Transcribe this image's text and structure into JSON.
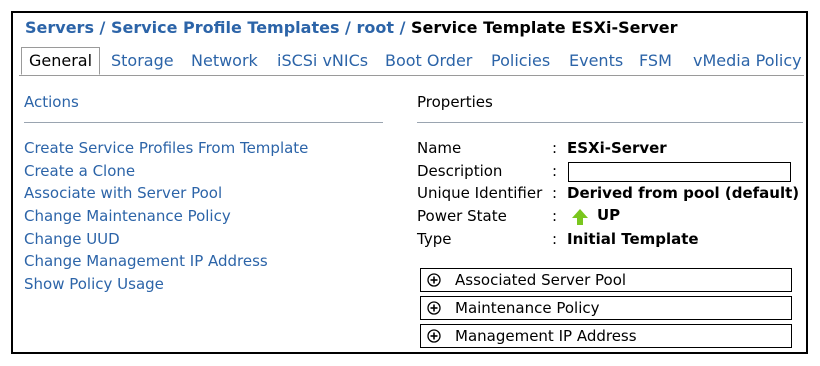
{
  "breadcrumb": {
    "servers": "Servers",
    "sep1": " / ",
    "spt": "Service Profile Templates",
    "sep2": " / ",
    "root": "root",
    "sep3": " / ",
    "current": "Service Template ESXi-Server"
  },
  "tabs": [
    {
      "label": "General",
      "active": true
    },
    {
      "label": "Storage"
    },
    {
      "label": "Network"
    },
    {
      "label": "iSCSi vNICs"
    },
    {
      "label": "Boot Order"
    },
    {
      "label": "Policies"
    },
    {
      "label": "Events"
    },
    {
      "label": "FSM"
    },
    {
      "label": "vMedia Policy"
    }
  ],
  "actions": {
    "title": "Actions",
    "items": [
      "Create Service Profiles From Template",
      "Create a Clone",
      "Associate with Server Pool",
      "Change Maintenance Policy",
      "Change UUD",
      "Change Management IP Address",
      "Show Policy Usage"
    ]
  },
  "properties": {
    "title": "Properties",
    "colon": ":",
    "name_label": "Name",
    "name_value": "ESXi-Server",
    "description_label": "Description",
    "description_value": "",
    "uid_label": "Unique Identifier",
    "uid_value": "Derived from pool (default)",
    "power_label": "Power State",
    "power_value": "UP",
    "power_icon": "up-arrow-icon",
    "type_label": "Type",
    "type_value": "Initial Template"
  },
  "expanders": [
    "Associated Server Pool",
    "Maintenance Policy",
    "Management IP Address"
  ],
  "colors": {
    "link": "#2c64a8",
    "power_up": "#7ac61e"
  }
}
